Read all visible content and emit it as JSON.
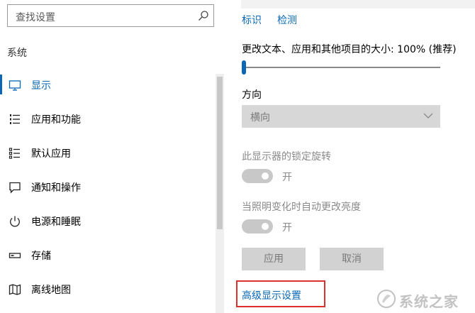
{
  "sidebar": {
    "search_placeholder": "查找设置",
    "section_title": "系统",
    "items": [
      {
        "label": "显示",
        "icon": "monitor-icon",
        "active": true
      },
      {
        "label": "应用和功能",
        "icon": "list-icon",
        "active": false
      },
      {
        "label": "默认应用",
        "icon": "default-apps-icon",
        "active": false
      },
      {
        "label": "通知和操作",
        "icon": "message-icon",
        "active": false
      },
      {
        "label": "电源和睡眠",
        "icon": "power-icon",
        "active": false
      },
      {
        "label": "存储",
        "icon": "storage-icon",
        "active": false
      },
      {
        "label": "离线地图",
        "icon": "map-icon",
        "active": false
      }
    ]
  },
  "main": {
    "links": {
      "identify": "标识",
      "detect": "检测"
    },
    "scale_label": "更改文本、应用和其他项目的大小: 100% (推荐)",
    "scale_slider_fraction": 0.0,
    "orientation_label": "方向",
    "orientation_value": "横向",
    "rotation_lock_label": "此显示器的锁定旋转",
    "rotation_lock_state": "开",
    "auto_brightness_label": "当照明变化时自动更改亮度",
    "auto_brightness_state": "开",
    "apply_button": "应用",
    "cancel_button": "取消",
    "advanced_link": "高级显示设置"
  },
  "watermark": {
    "text": "系统之家"
  },
  "colors": {
    "accent": "#0a67b5",
    "highlight_border": "#d9322e",
    "disabled_fill": "#d2d2d2"
  }
}
